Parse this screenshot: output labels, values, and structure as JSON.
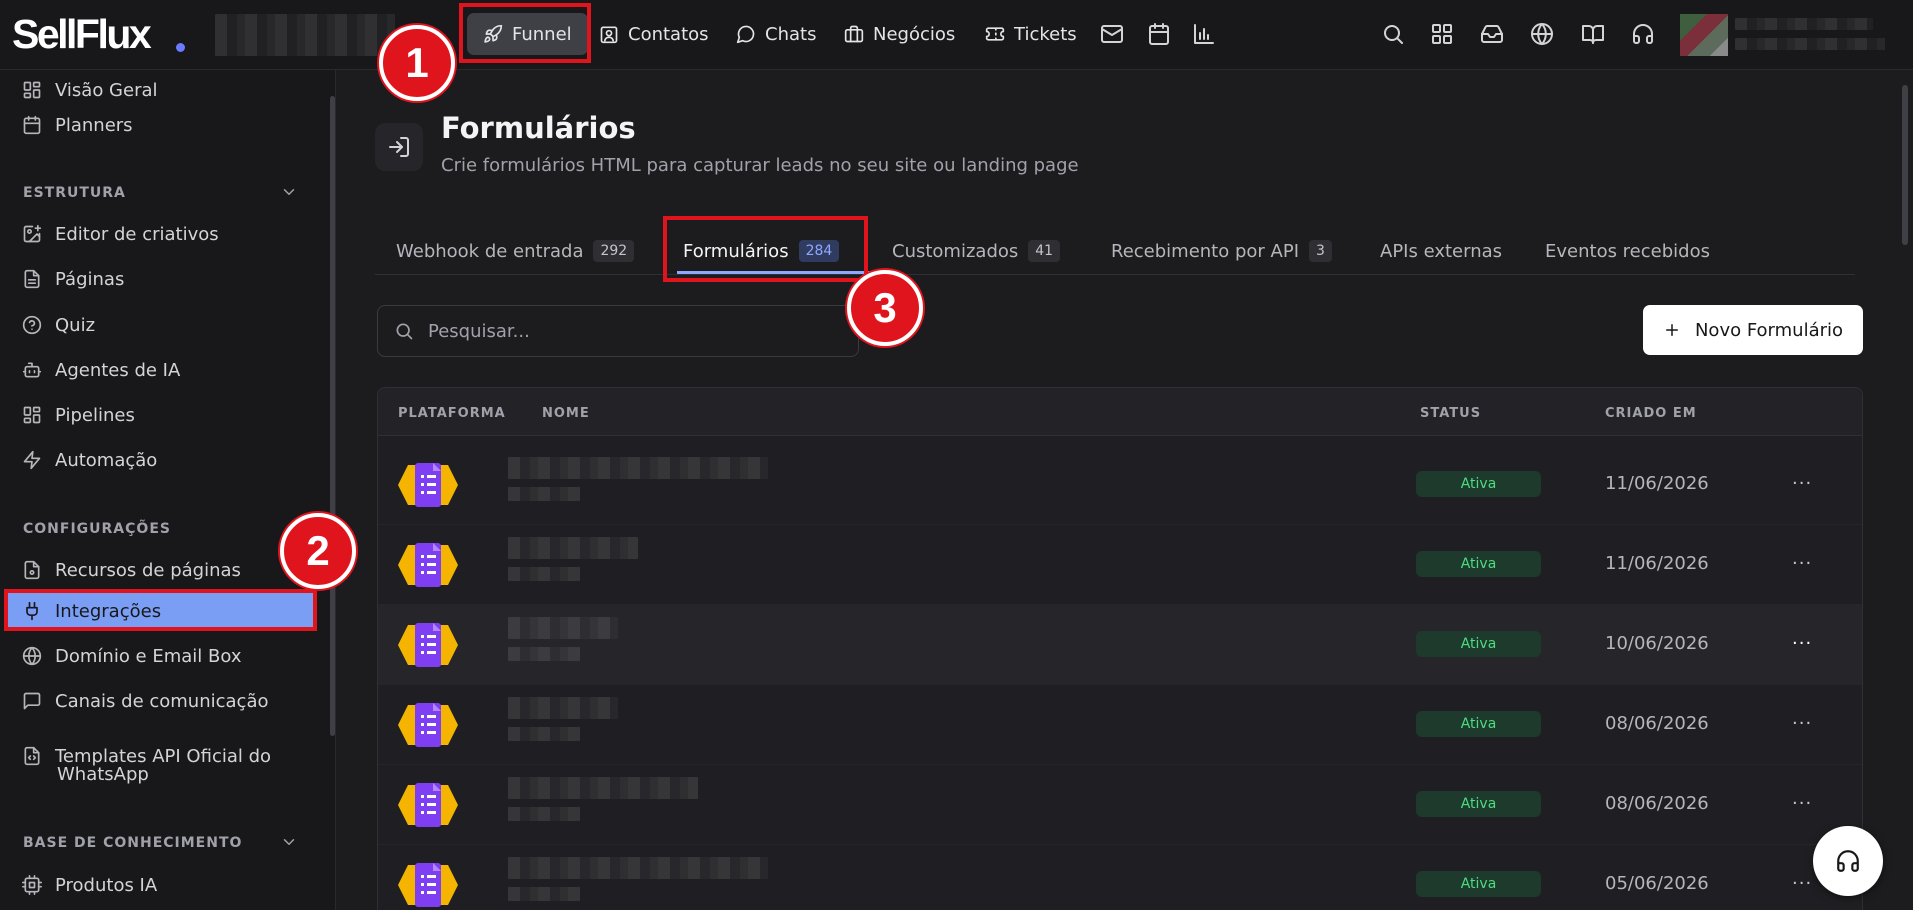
{
  "brand": {
    "logo": "SellFlux"
  },
  "topnav": {
    "items": [
      {
        "label": "Funnel",
        "icon": "rocket-icon",
        "active": true
      },
      {
        "label": "Contatos",
        "icon": "contact-icon"
      },
      {
        "label": "Chats",
        "icon": "chat-icon"
      },
      {
        "label": "Negócios",
        "icon": "briefcase-icon"
      },
      {
        "label": "Tickets",
        "icon": "ticket-icon"
      }
    ],
    "icon_buttons": [
      "mail-icon",
      "calendar-icon",
      "chart-icon"
    ],
    "right_icons": [
      "search-icon",
      "apps-icon",
      "inbox-icon",
      "globe-icon",
      "book-icon",
      "headset-icon"
    ]
  },
  "sidebar": {
    "top_items": [
      {
        "label": "Visão Geral",
        "icon": "grid-icon"
      },
      {
        "label": "Planners",
        "icon": "calendar-icon"
      }
    ],
    "sections": [
      {
        "title": "ESTRUTURA",
        "items": [
          {
            "label": "Editor de criativos",
            "icon": "image-edit-icon"
          },
          {
            "label": "Páginas",
            "icon": "file-icon"
          },
          {
            "label": "Quiz",
            "icon": "help-circle-icon"
          },
          {
            "label": "Agentes de IA",
            "icon": "bot-icon"
          },
          {
            "label": "Pipelines",
            "icon": "grid-icon"
          },
          {
            "label": "Automação",
            "icon": "zap-icon"
          }
        ]
      },
      {
        "title": "CONFIGURAÇÕES",
        "items": [
          {
            "label": "Recursos de páginas",
            "icon": "file-cog-icon"
          },
          {
            "label": "Integrações",
            "icon": "plug-icon",
            "active": true
          },
          {
            "label": "Domínio e Email Box",
            "icon": "globe-icon"
          },
          {
            "label": "Canais de comunicação",
            "icon": "message-square-icon"
          },
          {
            "label": "Templates API Oficial do",
            "label_line2": "WhatsApp",
            "icon": "file-code-icon"
          }
        ]
      },
      {
        "title": "BASE DE CONHECIMENTO",
        "items": [
          {
            "label": "Produtos IA",
            "icon": "cpu-icon"
          }
        ]
      }
    ]
  },
  "page": {
    "title": "Formulários",
    "subtitle": "Crie formulários HTML para capturar leads no seu site ou landing page",
    "icon": "login-icon"
  },
  "tabs": [
    {
      "label": "Webhook de entrada",
      "count": "292"
    },
    {
      "label": "Formulários",
      "count": "284",
      "active": true
    },
    {
      "label": "Customizados",
      "count": "41"
    },
    {
      "label": "Recebimento por API",
      "count": "3"
    },
    {
      "label": "APIs externas"
    },
    {
      "label": "Eventos recebidos"
    }
  ],
  "search": {
    "placeholder": "Pesquisar..."
  },
  "new_button": {
    "label": "Novo Formulário"
  },
  "table": {
    "columns": [
      "PLATAFORMA",
      "NOME",
      "STATUS",
      "CRIADO EM"
    ],
    "rows": [
      {
        "status": "Ativa",
        "date": "11/06/2026"
      },
      {
        "status": "Ativa",
        "date": "11/06/2026"
      },
      {
        "status": "Ativa",
        "date": "10/06/2026"
      },
      {
        "status": "Ativa",
        "date": "08/06/2026"
      },
      {
        "status": "Ativa",
        "date": "08/06/2026"
      },
      {
        "status": "Ativa",
        "date": "05/06/2026"
      }
    ],
    "row_menu": "···"
  },
  "annotations": [
    "1",
    "2",
    "3"
  ],
  "colors": {
    "accent": "#8fa7ff",
    "highlight": "#e0141d",
    "status_active": "#4ade80",
    "sidebar_active": "#7b9ef5"
  }
}
